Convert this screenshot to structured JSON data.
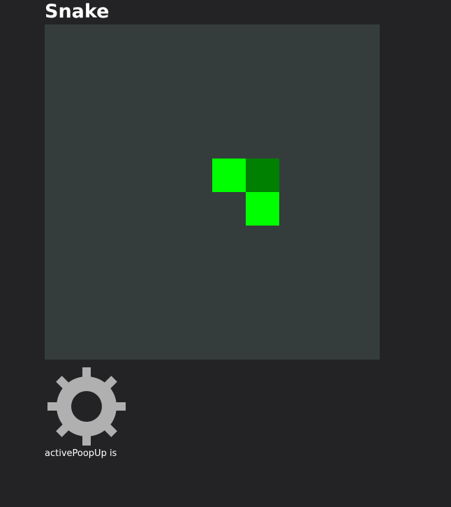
{
  "game": {
    "title": "Snake",
    "grid_columns": 10,
    "grid_rows": 10,
    "board_color": "#343d3c",
    "snake_color": "#00ff00",
    "head_color": "#008000",
    "snake": [
      {
        "col": 5,
        "row": 4,
        "part": "body"
      },
      {
        "col": 6,
        "row": 4,
        "part": "head"
      },
      {
        "col": 6,
        "row": 5,
        "part": "body"
      }
    ]
  },
  "settings": {
    "icon": "gear-icon",
    "color": "#b0b0b0"
  },
  "status": {
    "text": "activePoopUp is "
  }
}
